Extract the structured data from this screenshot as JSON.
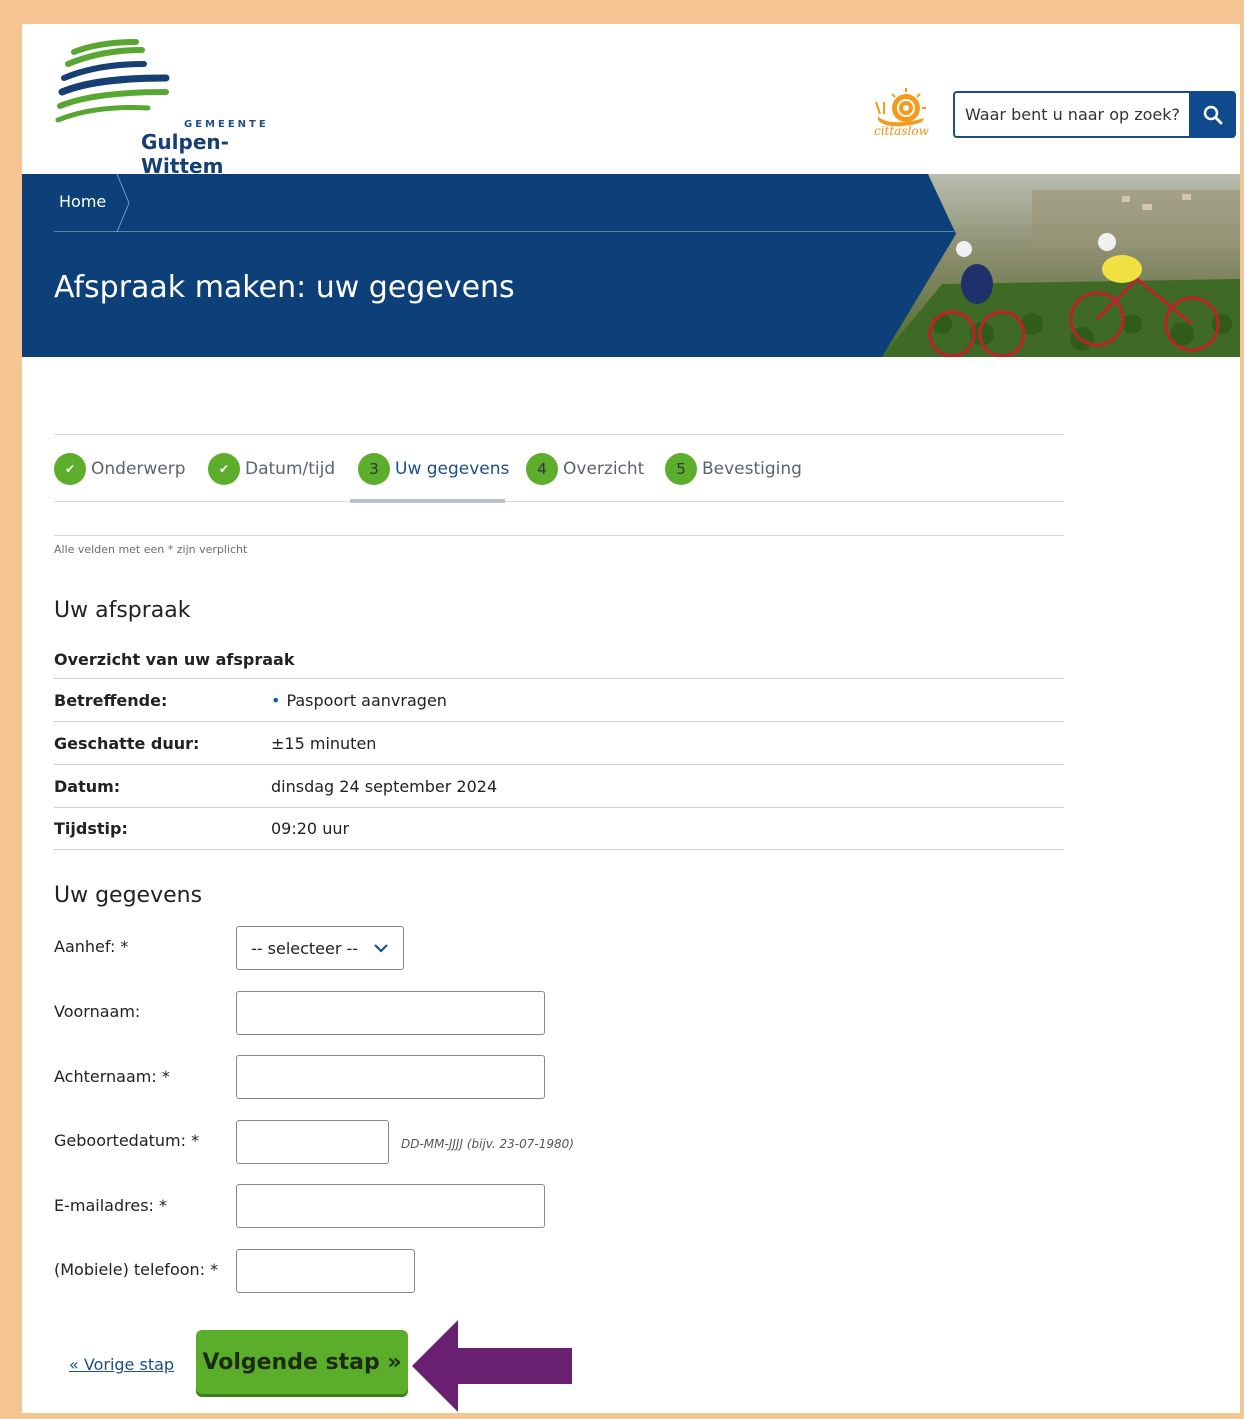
{
  "header": {
    "logo_top_text": "GEMEENTE",
    "logo_name": "Gulpen-Wittem",
    "cittaslow": "cittaslow",
    "search_placeholder": "Waar bent u naar op zoek?"
  },
  "banner": {
    "breadcrumb_home": "Home",
    "title": "Afspraak maken: uw gegevens"
  },
  "steps": [
    {
      "marker": "✔",
      "label": "Onderwerp",
      "state": "done"
    },
    {
      "marker": "✔",
      "label": "Datum/tijd",
      "state": "done"
    },
    {
      "marker": "3",
      "label": "Uw gegevens",
      "state": "active"
    },
    {
      "marker": "4",
      "label": "Overzicht",
      "state": "upcoming"
    },
    {
      "marker": "5",
      "label": "Bevestiging",
      "state": "upcoming"
    }
  ],
  "required_note": "Alle velden met een * zijn verplicht",
  "appointment": {
    "heading": "Uw afspraak",
    "subheading": "Overzicht van uw afspraak",
    "rows": [
      {
        "label": "Betreffende:",
        "value": "Paspoort aanvragen"
      },
      {
        "label": "Geschatte duur:",
        "value": "±15 minuten"
      },
      {
        "label": "Datum:",
        "value": "dinsdag 24 september 2024"
      },
      {
        "label": "Tijdstip:",
        "value": "09:20 uur"
      }
    ]
  },
  "form": {
    "heading": "Uw gegevens",
    "aanhef_label": "Aanhef: *",
    "aanhef_value": "-- selecteer --",
    "voornaam_label": "Voornaam:",
    "achternaam_label": "Achternaam: *",
    "geboortedatum_label": "Geboortedatum: *",
    "geboortedatum_hint": "DD-MM-JJJJ (bijv. 23-07-1980)",
    "email_label": "E-mailadres: *",
    "telefoon_label": "(Mobiele) telefoon: *"
  },
  "actions": {
    "prev": "« Vorige stap",
    "next": "Volgende stap »"
  },
  "colors": {
    "brand_blue": "#0d3f79",
    "step_green": "#5dae2c",
    "button_green": "#5bae2a",
    "annotation_arrow": "#6a2070",
    "frame": "#f7c593"
  }
}
